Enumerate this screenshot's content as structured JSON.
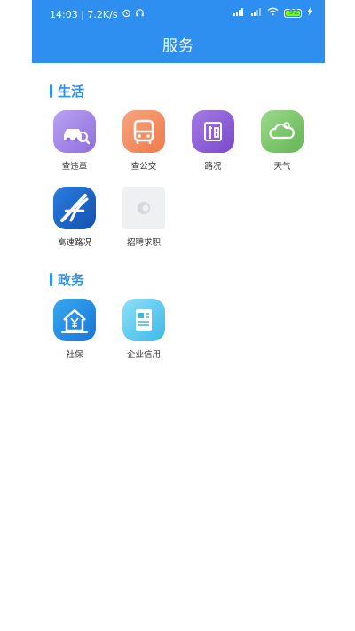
{
  "status_bar": {
    "time_speed": "14:03 | 7.2K/s",
    "battery": "92"
  },
  "header": {
    "title": "服务"
  },
  "sections": [
    {
      "title": "生活",
      "items": [
        {
          "label": "查违章",
          "icon": "car-icon"
        },
        {
          "label": "查公交",
          "icon": "bus-icon"
        },
        {
          "label": "路况",
          "icon": "road-icon"
        },
        {
          "label": "天气",
          "icon": "cloud-icon"
        },
        {
          "label": "高速路况",
          "icon": "highway-icon"
        },
        {
          "label": "招聘求职",
          "icon": "placeholder-icon"
        }
      ]
    },
    {
      "title": "政务",
      "items": [
        {
          "label": "社保",
          "icon": "house-yen-icon"
        },
        {
          "label": "企业信用",
          "icon": "document-icon"
        }
      ]
    }
  ],
  "colors": {
    "primary": "#2f8ff0",
    "violation": "#9b7be0",
    "bus": "#f2875a",
    "road": "#8a5bd6",
    "weather": "#7cc86a",
    "highway": "#1a66c8",
    "social": "#1f8be0",
    "credit": "#5fd0f0"
  }
}
